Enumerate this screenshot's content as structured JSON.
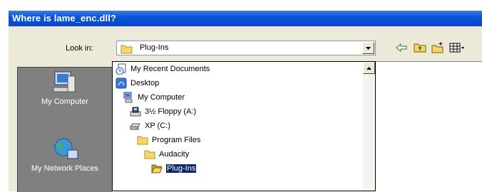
{
  "dialog": {
    "title": "Where is lame_enc.dll?"
  },
  "lookin": {
    "label": "Look in:",
    "value": "Plug-Ins"
  },
  "places": [
    {
      "label": "My Computer"
    },
    {
      "label": "My Network Places"
    }
  ],
  "dropdown": {
    "items": [
      {
        "label": "My Recent Documents",
        "icon": "recent-documents-icon",
        "indent": 0
      },
      {
        "label": "Desktop",
        "icon": "desktop-icon",
        "indent": 0
      },
      {
        "label": "My Computer",
        "icon": "my-computer-icon",
        "indent": 1
      },
      {
        "label": "3½ Floppy (A:)",
        "icon": "floppy-drive-icon",
        "indent": 2
      },
      {
        "label": "XP (C:)",
        "icon": "hard-drive-icon",
        "indent": 2
      },
      {
        "label": "Program Files",
        "icon": "folder-icon",
        "indent": 3
      },
      {
        "label": "Audacity",
        "icon": "folder-icon",
        "indent": 4
      },
      {
        "label": "Plug-Ins",
        "icon": "open-folder-icon",
        "indent": 5,
        "selected": true
      }
    ]
  },
  "colors": {
    "titlebar": "#0a55d8",
    "selection": "#0a246a",
    "places_bg": "#808080"
  }
}
